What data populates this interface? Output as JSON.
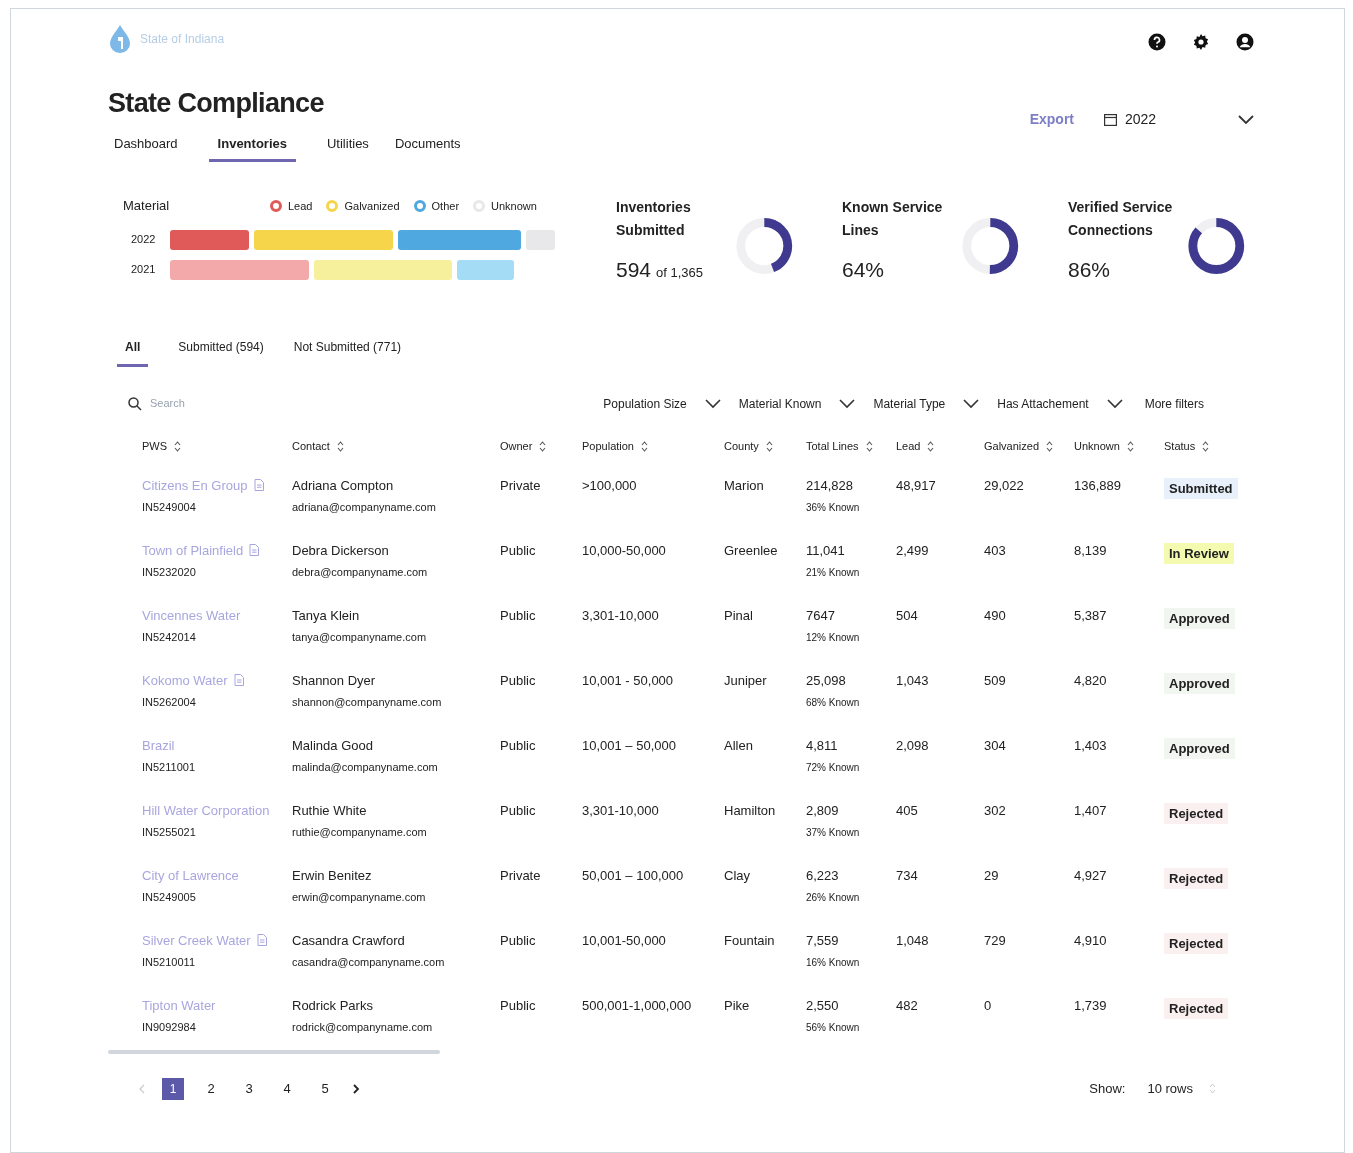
{
  "brand": {
    "name": "State of Indiana"
  },
  "title": "State Compliance",
  "nav_tabs": [
    {
      "label": "Dashboard",
      "selected": false
    },
    {
      "label": "Inventories",
      "selected": true
    },
    {
      "label": "Utilities",
      "selected": false
    },
    {
      "label": "Documents",
      "selected": false
    }
  ],
  "export": "Export",
  "year_picker": {
    "value": "2022"
  },
  "material": {
    "title": "Material",
    "legend": [
      {
        "label": "Lead",
        "color": "#e05a5a"
      },
      {
        "label": "Galvanized",
        "color": "#f7d54a"
      },
      {
        "label": "Other",
        "color": "#4fa8e0"
      },
      {
        "label": "Unknown",
        "color": "#e8e8ea"
      }
    ],
    "bars": [
      {
        "year": "2022"
      },
      {
        "year": "2021"
      }
    ]
  },
  "stats": [
    {
      "title": "Inventories Submitted",
      "value": "594",
      "suffix": "of 1,365",
      "level": 0.44
    },
    {
      "title": "Known Service Lines",
      "value": "64%",
      "level": 0.5
    },
    {
      "title": "Verified Service Connections",
      "value": "86%",
      "level": 0.86
    }
  ],
  "filter_tabs": [
    {
      "label": "All",
      "selected": true
    },
    {
      "label": "Submitted (594)",
      "selected": false
    },
    {
      "label": "Not Submitted (771)",
      "selected": false
    }
  ],
  "search": {
    "placeholder": "Search"
  },
  "filters": [
    "Population Size",
    "Material Known",
    "Material Type",
    "Has Attachement"
  ],
  "more_filters": "More filters",
  "table": {
    "columns": [
      "PWS",
      "Contact",
      "Owner",
      "Population",
      "County",
      "Total Lines",
      "Lead",
      "Galvanized",
      "Unknown",
      "Status"
    ],
    "rows": [
      {
        "pws": "Citizens En Group",
        "has_document": true,
        "pws_id": "IN5249004",
        "contact": "Adriana Compton",
        "email": "adriana@companyname.com",
        "owner": "Private",
        "population": ">100,000",
        "county": "Marion",
        "total": "214,828",
        "known": "36% Known",
        "lead": "48,917",
        "galvanized": "29,022",
        "unknown": "136,889",
        "status": {
          "kind": "submitted",
          "label": "Submitted"
        }
      },
      {
        "pws": "Town of Plainfield",
        "has_document": true,
        "pws_id": "IN5232020",
        "contact": "Debra Dickerson",
        "email": "debra@companyname.com",
        "owner": "Public",
        "population": "10,000-50,000",
        "county": "Greenlee",
        "total": "11,041",
        "known": "21% Known",
        "lead": "2,499",
        "galvanized": "403",
        "unknown": "8,139",
        "status": {
          "kind": "review",
          "label": "In Review"
        }
      },
      {
        "pws": "Vincennes Water",
        "has_document": false,
        "pws_id": "IN5242014",
        "contact": "Tanya Klein",
        "email": "tanya@companyname.com",
        "owner": "Public",
        "population": "3,301-10,000",
        "county": "Pinal",
        "total": "7647",
        "known": "12% Known",
        "lead": "504",
        "galvanized": "490",
        "unknown": "5,387",
        "status": {
          "kind": "approved",
          "label": "Approved"
        }
      },
      {
        "pws": "Kokomo Water",
        "has_document": true,
        "pws_id": "IN5262004",
        "contact": "Shannon Dyer",
        "email": "shannon@companyname.com",
        "owner": "Public",
        "population": "10,001 - 50,000",
        "county": "Juniper",
        "total": "25,098",
        "known": "68% Known",
        "lead": "1,043",
        "galvanized": "509",
        "unknown": "4,820",
        "status": {
          "kind": "approved",
          "label": "Approved"
        }
      },
      {
        "pws": "Brazil",
        "has_document": false,
        "pws_id": "IN5211001",
        "contact": "Malinda Good",
        "email": "malinda@companyname.com",
        "owner": "Public",
        "population": "10,001 – 50,000",
        "county": "Allen",
        "total": "4,811",
        "known": "72% Known",
        "lead": "2,098",
        "galvanized": "304",
        "unknown": "1,403",
        "status": {
          "kind": "approved",
          "label": "Approved"
        }
      },
      {
        "pws": "Hill Water Corporation",
        "has_document": false,
        "pws_id": "IN5255021",
        "contact": "Ruthie White",
        "email": "ruthie@companyname.com",
        "owner": "Public",
        "population": "3,301-10,000",
        "county": "Hamilton",
        "total": "2,809",
        "known": "37% Known",
        "lead": "405",
        "galvanized": "302",
        "unknown": "1,407",
        "status": {
          "kind": "rejected",
          "label": "Rejected"
        }
      },
      {
        "pws": "City of Lawrence",
        "has_document": false,
        "pws_id": "IN5249005",
        "contact": "Erwin Benitez",
        "email": "erwin@companyname.com",
        "owner": "Private",
        "population": "50,001 – 100,000",
        "county": "Clay",
        "total": "6,223",
        "known": "26% Known",
        "lead": "734",
        "galvanized": "29",
        "unknown": "4,927",
        "status": {
          "kind": "rejected",
          "label": "Rejected"
        }
      },
      {
        "pws": "Silver Creek Water",
        "has_document": true,
        "pws_id": "IN5210011",
        "contact": "Casandra Crawford",
        "email": "casandra@companyname.com",
        "owner": "Public",
        "population": "10,001-50,000",
        "county": "Fountain",
        "total": "7,559",
        "known": "16% Known",
        "lead": "1,048",
        "galvanized": "729",
        "unknown": "4,910",
        "status": {
          "kind": "rejected",
          "label": "Rejected"
        }
      },
      {
        "pws": "Tipton Water",
        "has_document": false,
        "pws_id": "IN9092984",
        "contact": "Rodrick Parks",
        "email": "rodrick@companyname.com",
        "owner": "Public",
        "population": "500,001-1,000,000",
        "county": "Pike",
        "total": "2,550",
        "known": "56% Known",
        "lead": "482",
        "galvanized": "0",
        "unknown": "1,739",
        "status": {
          "kind": "rejected",
          "label": "Rejected"
        }
      }
    ]
  },
  "pagination": {
    "pages": [
      {
        "label": "1",
        "selected": true
      },
      {
        "label": "2",
        "selected": false
      },
      {
        "label": "3",
        "selected": false
      },
      {
        "label": "4",
        "selected": false
      },
      {
        "label": "5",
        "selected": false
      }
    ],
    "show_label": "Show:",
    "rows_value": "10 rows"
  }
}
